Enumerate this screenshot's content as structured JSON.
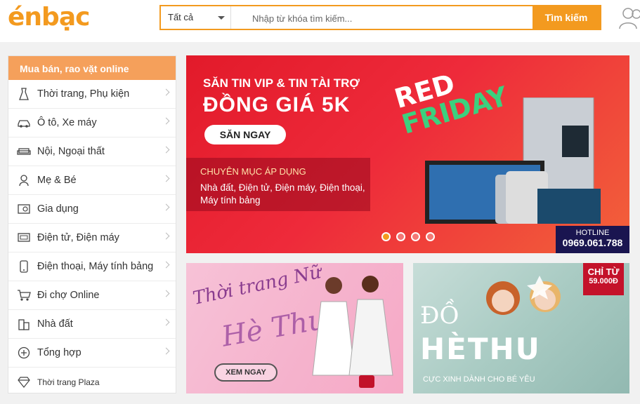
{
  "header": {
    "logo": "énbạc",
    "category": "Tất cả",
    "search_placeholder": "Nhập từ khóa tìm kiếm...",
    "search_button": "Tìm kiếm"
  },
  "sidebar": {
    "title": "Mua bán, rao vặt online",
    "items": [
      {
        "label": "Thời trang, Phụ kiện",
        "icon": "dress-icon"
      },
      {
        "label": "Ô tô, Xe máy",
        "icon": "car-icon"
      },
      {
        "label": "Nội, Ngoại thất",
        "icon": "sofa-icon"
      },
      {
        "label": "Mẹ & Bé",
        "icon": "baby-icon"
      },
      {
        "label": "Gia dụng",
        "icon": "appliance-icon"
      },
      {
        "label": "Điện tử, Điện máy",
        "icon": "tv-icon"
      },
      {
        "label": "Điện thoại, Máy tính bảng",
        "icon": "phone-icon"
      },
      {
        "label": "Đi chợ Online",
        "icon": "cart-icon"
      },
      {
        "label": "Nhà đất",
        "icon": "building-icon"
      },
      {
        "label": "Tổng hợp",
        "icon": "plus-circle-icon"
      },
      {
        "label": "Thời trang Plaza",
        "icon": "diamond-icon"
      }
    ]
  },
  "banner": {
    "line1": "SĂN TIN VIP & TIN TÀI TRỢ",
    "line2": "ĐỒNG GIÁ 5K",
    "cta": "SĂN NGAY",
    "section_title": "CHUYÊN MỤC ÁP DỤNG",
    "section_text": "Nhà đất, Điện tử, Điện máy, Điện thoại, Máy tính bảng",
    "red": "RED",
    "friday": "FRIDAY",
    "hotline_label": "HOTLINE",
    "hotline": "0969.061.788",
    "slides": 4,
    "active_slide": 1
  },
  "card1": {
    "script1": "Thời trang Nữ",
    "script2": "Hè Thu",
    "cta": "XEM NGAY"
  },
  "card2": {
    "line1": "ĐỒ",
    "line2": "HÈTHU",
    "sub": "CỰC XINH DÀNH CHO BÉ YÊU",
    "tag1": "CHỈ TỪ",
    "tag2": "59.000Đ"
  },
  "colors": {
    "accent": "#f39a1f",
    "sidebar_title": "#f5a05b",
    "banner_red": "#e21a2a"
  }
}
